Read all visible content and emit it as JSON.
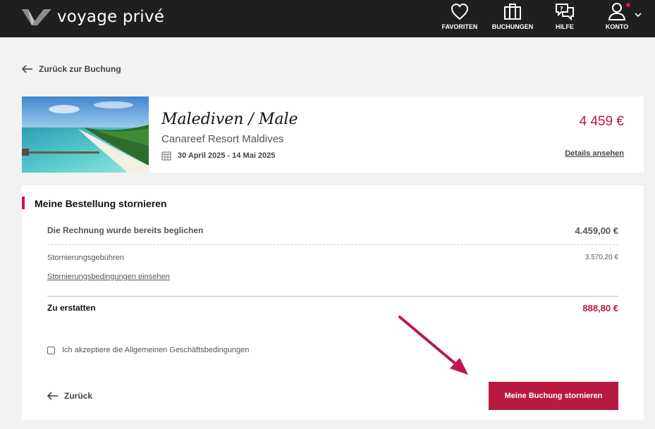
{
  "header": {
    "logo_text": "voyage privé",
    "nav": [
      {
        "label": "FAVORITEN",
        "icon": "heart-icon"
      },
      {
        "label": "BUCHUNGEN",
        "icon": "suitcase-icon"
      },
      {
        "label": "HILFE",
        "icon": "chat-icon"
      },
      {
        "label": "KONTO",
        "icon": "user-icon"
      }
    ]
  },
  "back_link": "Zurück zur Buchung",
  "booking": {
    "title": "Malediven / Male",
    "hotel": "Canareef Resort Maldives",
    "dates": "30 April 2025 - 14 Mai 2025",
    "price": "4 459 €",
    "details_link": "Details ansehen"
  },
  "cancellation": {
    "title": "Meine Bestellung stornieren",
    "paid_label": "Die Rechnung wurde bereits beglichen",
    "paid_amount": "4.459,00 €",
    "fees_label": "Stornierungsgebühren",
    "fees_amount": "3.570,20 €",
    "conditions_link": "Stornierungsbedingungen einsehen",
    "refund_label": "Zu erstatten",
    "refund_amount": "888,80 €",
    "terms_label": "Ich akzeptiere die Allgemeinen Geschäftsbedingungen",
    "back_label": "Zurück",
    "cancel_button": "Meine Buchung stornieren"
  },
  "colors": {
    "accent": "#b8193f",
    "header_bg": "#1f1f1f",
    "page_bg": "#f2f2f2"
  }
}
